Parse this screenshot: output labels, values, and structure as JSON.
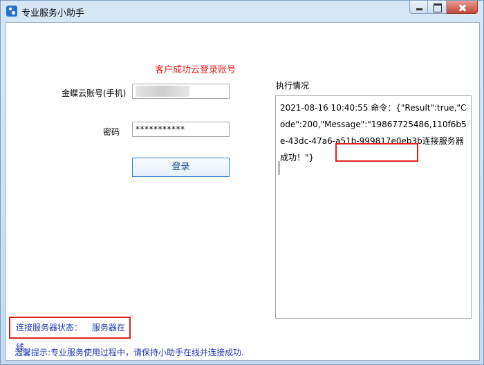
{
  "window": {
    "title": "专业服务小助手"
  },
  "notice": {
    "success": "客户成功云登录账号"
  },
  "form": {
    "account_label": "金蝶云账号(手机)",
    "password_label": "密码",
    "password_value": "***********",
    "login_label": "登录"
  },
  "log": {
    "title": "执行情况",
    "content": "2021-08-16 10:40:55 命令：{\"Result\":true,\"Code\":200,\"Message\":\"19867725486,110f6b5e-43dc-47a6-a51b-999817e0eb3b连接服务器成功！\"}"
  },
  "status": {
    "label": "连接服务器状态：",
    "value": "服务器在线"
  },
  "tip": {
    "text": "温馨提示:专业服务使用过程中，请保持小助手在线并连接成功."
  },
  "colors": {
    "accent_red": "#e0201c",
    "status_blue": "#1a35b5",
    "button_border": "#2f7fc9"
  }
}
